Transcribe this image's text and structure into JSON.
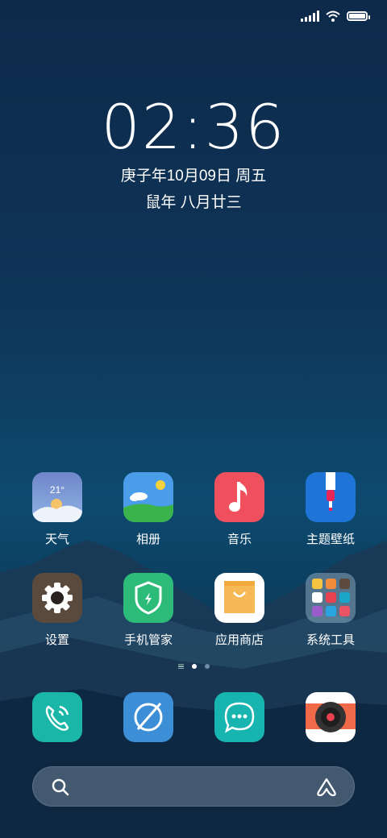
{
  "status_bar": {
    "signal_icon": "signal-icon",
    "wifi_icon": "wifi-icon",
    "battery_icon": "battery-icon",
    "battery_level": 1.0
  },
  "clock": {
    "time": "02:36",
    "date_line": "庚子年10月09日 周五",
    "lunar_line": "鼠年 八月廿三"
  },
  "apps": [
    {
      "label": "天气",
      "icon": "weather-icon",
      "temp": "21°"
    },
    {
      "label": "相册",
      "icon": "gallery-icon"
    },
    {
      "label": "音乐",
      "icon": "music-icon"
    },
    {
      "label": "主题壁纸",
      "icon": "themes-icon"
    },
    {
      "label": "设置",
      "icon": "settings-icon"
    },
    {
      "label": "手机管家",
      "icon": "security-icon"
    },
    {
      "label": "应用商店",
      "icon": "app-store-icon"
    },
    {
      "label": "系统工具",
      "icon": "folder-icon"
    }
  ],
  "pager": {
    "pages": 2,
    "current": 1
  },
  "dock": [
    {
      "icon": "phone-icon"
    },
    {
      "icon": "browser-icon"
    },
    {
      "icon": "messages-icon"
    },
    {
      "icon": "camera-icon"
    }
  ],
  "search": {
    "search_icon": "search-icon",
    "assistant_icon": "assistant-icon"
  },
  "colors": {
    "weather": "#7fa4e0",
    "gallery": "#4a9de8",
    "music": "#f0505e",
    "themes": "#1f74d8",
    "settings": "#5a4a3e",
    "security": "#2dbb7a",
    "store": "#ffffff",
    "phone": "#1ab6a8",
    "browser": "#3c8ed6",
    "messages": "#18b5b0",
    "camera": "#ffffff"
  }
}
